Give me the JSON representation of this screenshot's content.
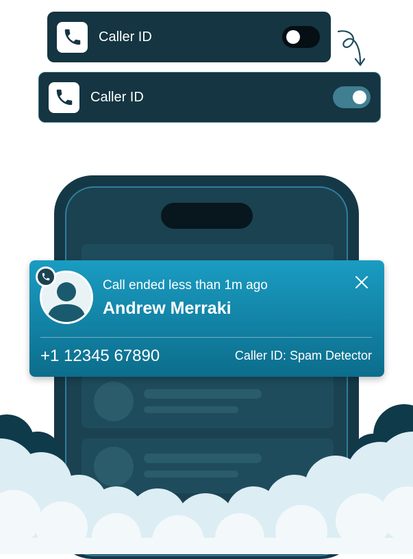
{
  "caller_id_card_off": {
    "label": "Caller ID",
    "toggle_state": "off"
  },
  "caller_id_card_on": {
    "label": "Caller ID",
    "toggle_state": "on"
  },
  "notification": {
    "subtitle": "Call ended less than 1m ago",
    "caller_name": "Andrew Merraki",
    "phone_number": "+1 12345 67890",
    "source": "Caller ID: Spam Detector"
  },
  "icons": {
    "app": "phone-icon",
    "close": "close-icon",
    "arrow": "curly-arrow-icon",
    "avatar": "user-avatar-icon"
  },
  "colors": {
    "card_bg": "#143541",
    "toggle_on": "#3f7f91",
    "notification_top": "#1a9cc2",
    "notification_bottom": "#0c6d8c",
    "phone_body": "#153846",
    "cloud": "#dcedf4"
  }
}
